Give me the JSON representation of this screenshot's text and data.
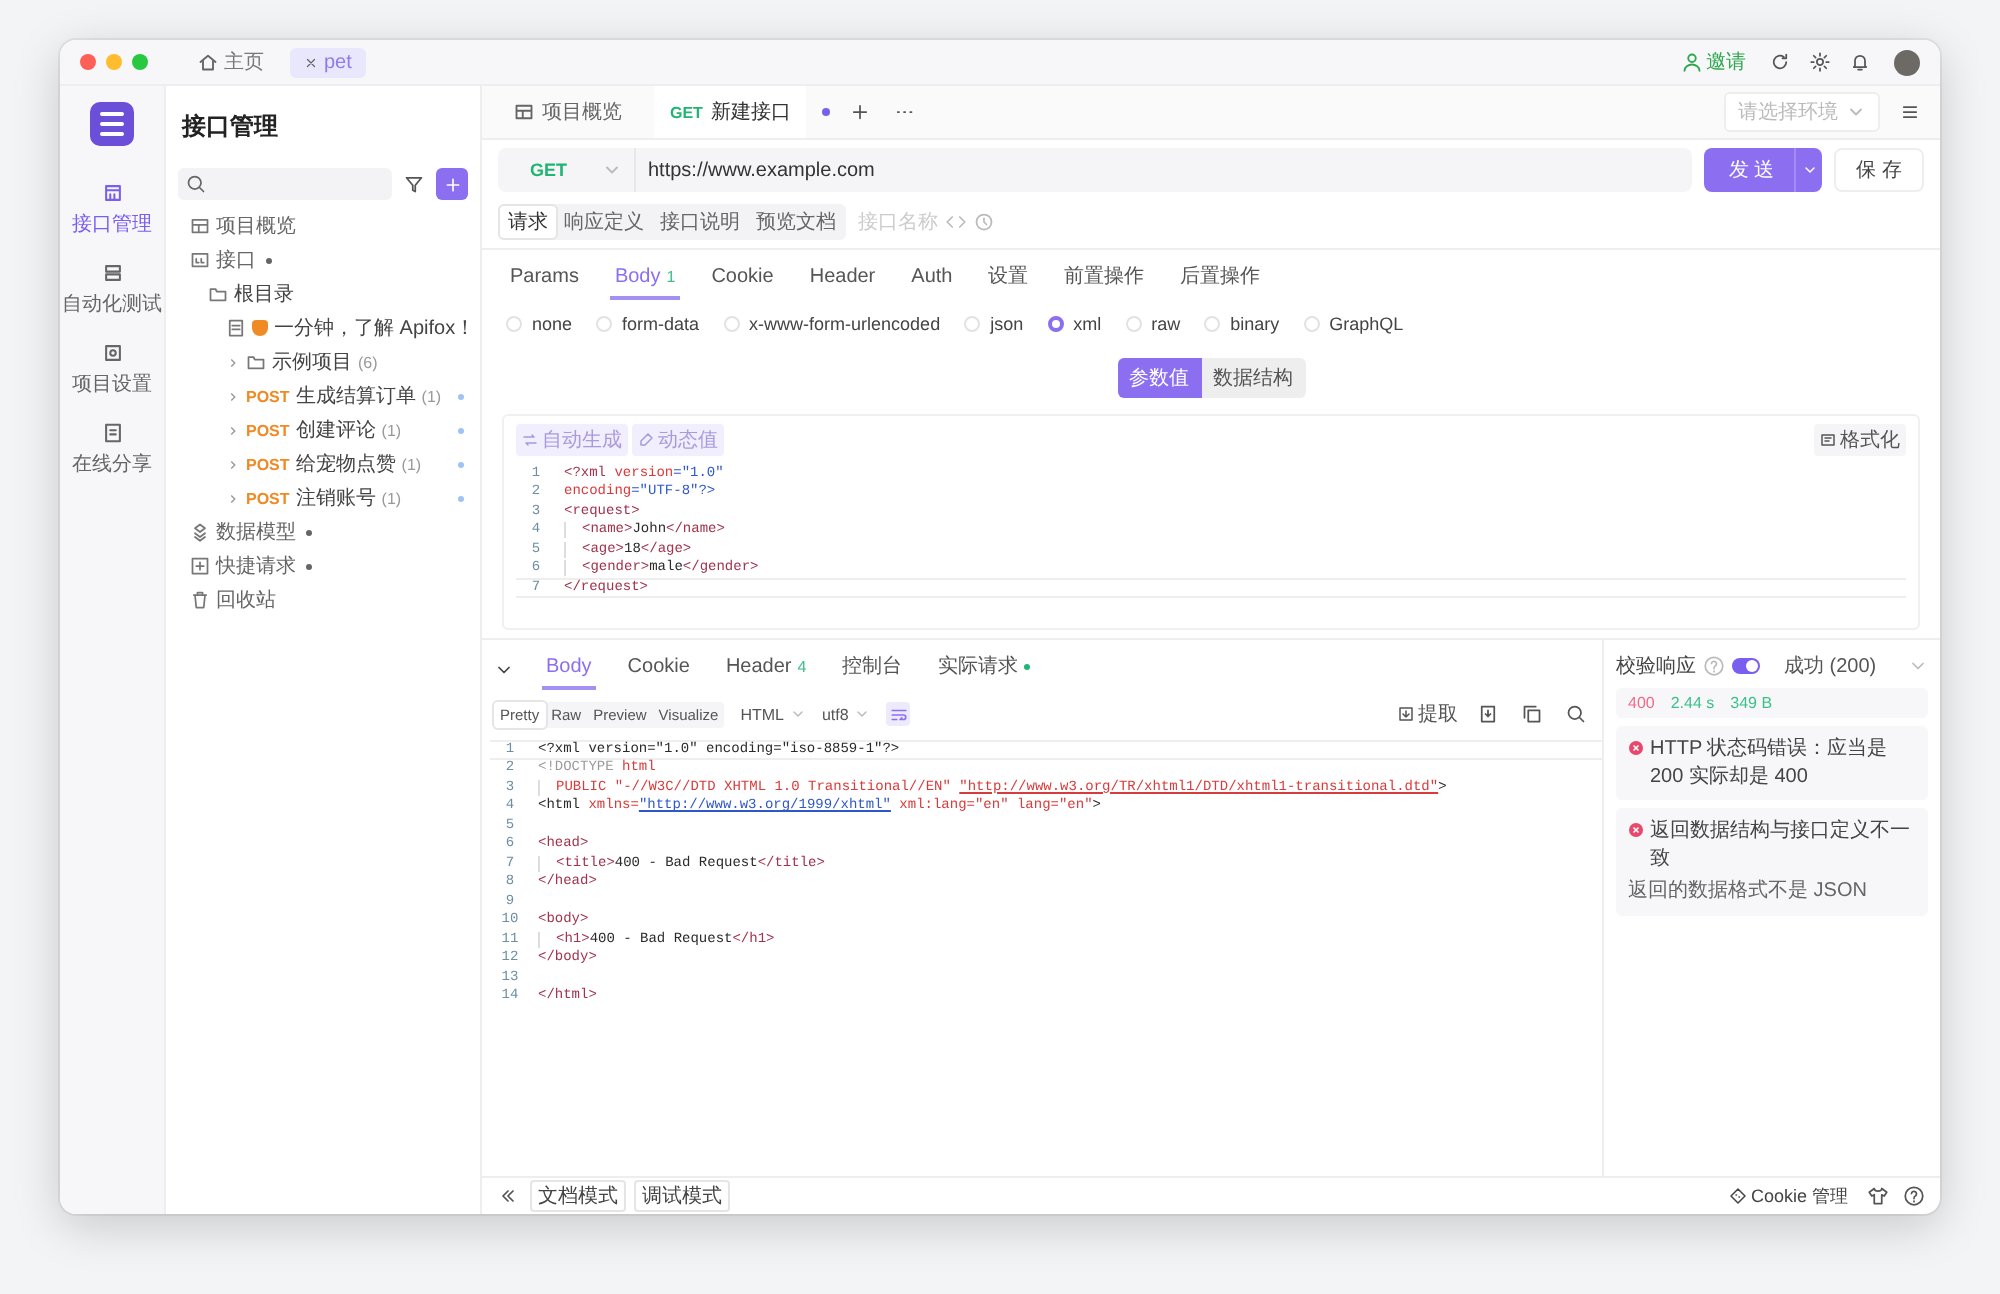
{
  "titlebar": {
    "tabs": [
      {
        "kind": "home",
        "label": "主页",
        "selected": false
      },
      {
        "kind": "project",
        "label": "pet",
        "selected": true
      }
    ],
    "invite": "邀请"
  },
  "rail": {
    "items": [
      {
        "kind": "api",
        "label": "接口管理",
        "selected": true
      },
      {
        "kind": "test",
        "label": "自动化测试",
        "selected": false
      },
      {
        "kind": "settings",
        "label": "项目设置",
        "selected": false
      },
      {
        "kind": "share",
        "label": "在线分享",
        "selected": false
      }
    ]
  },
  "sidebar": {
    "title": "接口管理",
    "tree": [
      {
        "kind": "overview",
        "label": "项目概览"
      },
      {
        "kind": "module",
        "label": "接口",
        "children": [
          {
            "kind": "folder",
            "label": "根目录",
            "children": [
              {
                "kind": "doc",
                "label": "一分钟，了解 Apifox！"
              },
              {
                "kind": "folder",
                "label": "示例项目",
                "count": "(6)",
                "expanded": false
              },
              {
                "kind": "endpoint",
                "method": "POST",
                "label": "生成结算订单",
                "count": "(1)",
                "expanded": false
              },
              {
                "kind": "endpoint",
                "method": "POST",
                "label": "创建评论",
                "count": "(1)",
                "expanded": false
              },
              {
                "kind": "endpoint",
                "method": "POST",
                "label": "给宠物点赞",
                "count": "(1)",
                "expanded": false
              },
              {
                "kind": "endpoint",
                "method": "POST",
                "label": "注销账号",
                "count": "(1)",
                "expanded": false
              }
            ]
          }
        ]
      },
      {
        "kind": "models",
        "label": "数据模型"
      },
      {
        "kind": "quick",
        "label": "快捷请求"
      },
      {
        "kind": "trash",
        "label": "回收站"
      }
    ]
  },
  "tabs": [
    {
      "kind": "overview",
      "label": "项目概览",
      "selected": false
    },
    {
      "kind": "endpoint",
      "method": "GET",
      "label": "新建接口",
      "selected": true,
      "unsaved": true
    }
  ],
  "environment": {
    "placeholder": "请选择环境"
  },
  "request": {
    "method": "GET",
    "url": "https://www.example.com",
    "send": "发 送",
    "save": "保 存"
  },
  "sections": [
    {
      "label": "请求",
      "selected": true
    },
    {
      "label": "响应定义",
      "selected": false
    },
    {
      "label": "接口说明",
      "selected": false
    },
    {
      "label": "预览文档",
      "selected": false
    }
  ],
  "name_field": {
    "placeholder": "接口名称"
  },
  "request_tabs": [
    {
      "label": "Params",
      "selected": false
    },
    {
      "label": "Body",
      "count": "1",
      "selected": true
    },
    {
      "label": "Cookie",
      "selected": false
    },
    {
      "label": "Header",
      "selected": false
    },
    {
      "label": "Auth",
      "selected": false
    },
    {
      "label": "设置",
      "selected": false
    },
    {
      "label": "前置操作",
      "selected": false
    },
    {
      "label": "后置操作",
      "selected": false
    }
  ],
  "body_types": [
    {
      "label": "none",
      "selected": false
    },
    {
      "label": "form-data",
      "selected": false
    },
    {
      "label": "x-www-form-urlencoded",
      "selected": false
    },
    {
      "label": "json",
      "selected": false
    },
    {
      "label": "xml",
      "selected": true
    },
    {
      "label": "raw",
      "selected": false
    },
    {
      "label": "binary",
      "selected": false
    },
    {
      "label": "GraphQL",
      "selected": false
    }
  ],
  "views": [
    {
      "label": "参数值",
      "selected": true
    },
    {
      "label": "数据结构",
      "selected": false
    }
  ],
  "editor": {
    "tools": [
      {
        "kind": "generate",
        "label": "自动生成"
      },
      {
        "kind": "dynamic",
        "label": "动态值"
      }
    ],
    "format": "格式化",
    "lines": [
      {
        "number": "1",
        "tokens": [
          {
            "kind": "tag",
            "text": "<?xml "
          },
          {
            "kind": "attr",
            "text": "version"
          },
          {
            "kind": "string",
            "text": "=\"1.0\""
          }
        ]
      },
      {
        "number": "2",
        "tokens": [
          {
            "kind": "attr",
            "text": "encoding"
          },
          {
            "kind": "string",
            "text": "=\"UTF-8\"?>"
          }
        ]
      },
      {
        "number": "3",
        "tokens": [
          {
            "kind": "tag",
            "text": "<request>"
          }
        ]
      },
      {
        "number": "4",
        "indented": true,
        "tokens": [
          {
            "kind": "tag",
            "text": "<name>"
          },
          {
            "kind": "text",
            "text": "John"
          },
          {
            "kind": "tag",
            "text": "</name>"
          }
        ]
      },
      {
        "number": "5",
        "indented": true,
        "tokens": [
          {
            "kind": "tag",
            "text": "<age>"
          },
          {
            "kind": "text",
            "text": "18"
          },
          {
            "kind": "tag",
            "text": "</age>"
          }
        ]
      },
      {
        "number": "6",
        "indented": true,
        "tokens": [
          {
            "kind": "tag",
            "text": "<gender>"
          },
          {
            "kind": "text",
            "text": "male"
          },
          {
            "kind": "tag",
            "text": "</gender>"
          }
        ]
      },
      {
        "number": "7",
        "cursor": true,
        "tokens": [
          {
            "kind": "tag",
            "text": "</request>"
          }
        ]
      }
    ]
  },
  "response": {
    "tabs": [
      {
        "label": "Body",
        "selected": true
      },
      {
        "label": "Cookie",
        "selected": false
      },
      {
        "label": "Header",
        "count": "4",
        "selected": false
      },
      {
        "label": "控制台",
        "selected": false
      },
      {
        "label": "实际请求",
        "dot": true,
        "selected": false
      }
    ],
    "modes": [
      {
        "label": "Pretty",
        "selected": true
      },
      {
        "label": "Raw",
        "selected": false
      },
      {
        "label": "Preview",
        "selected": false
      },
      {
        "label": "Visualize",
        "selected": false
      }
    ],
    "format": "HTML",
    "encoding": "utf8",
    "extract": "提取",
    "lines": [
      {
        "number": "1",
        "cursor": true,
        "tokens": [
          {
            "kind": "text",
            "text": "<?xml version=\"1.0\" encoding=\"iso-8859-1\"?>"
          }
        ]
      },
      {
        "number": "2",
        "tokens": [
          {
            "kind": "meta",
            "text": "<!DOCTYPE "
          },
          {
            "kind": "attr",
            "text": "html"
          }
        ]
      },
      {
        "number": "3",
        "indented": true,
        "tokens": [
          {
            "kind": "attr",
            "text": "PUBLIC \"-//W3C//DTD XHTML 1.0 Transitional//EN\" "
          },
          {
            "kind": "link",
            "text": "\"http://www.w3.org/TR/xhtml1/DTD/xhtml1-transitional.dtd\""
          },
          {
            "kind": "text",
            "text": ">"
          }
        ]
      },
      {
        "number": "4",
        "tokens": [
          {
            "kind": "text",
            "text": "<html "
          },
          {
            "kind": "attr",
            "text": "xmlns="
          },
          {
            "kind": "url",
            "text": "\"http://www.w3.org/1999/xhtml\""
          },
          {
            "kind": "attr",
            "text": " xml:lang=\"en\" lang=\"en\""
          },
          {
            "kind": "text",
            "text": ">"
          }
        ]
      },
      {
        "number": "5"
      },
      {
        "number": "6",
        "tokens": [
          {
            "kind": "tag",
            "text": "<head>"
          }
        ]
      },
      {
        "number": "7",
        "indented": true,
        "tokens": [
          {
            "kind": "tag",
            "text": "<title>"
          },
          {
            "kind": "text",
            "text": "400 - Bad Request"
          },
          {
            "kind": "tag",
            "text": "</title>"
          }
        ]
      },
      {
        "number": "8",
        "tokens": [
          {
            "kind": "tag",
            "text": "</head>"
          }
        ]
      },
      {
        "number": "9"
      },
      {
        "number": "10",
        "tokens": [
          {
            "kind": "tag",
            "text": "<body>"
          }
        ]
      },
      {
        "number": "11",
        "indented": true,
        "tokens": [
          {
            "kind": "tag",
            "text": "<h1>"
          },
          {
            "kind": "text",
            "text": "400 - Bad Request"
          },
          {
            "kind": "tag",
            "text": "</h1>"
          }
        ]
      },
      {
        "number": "12",
        "tokens": [
          {
            "kind": "tag",
            "text": "</body>"
          }
        ]
      },
      {
        "number": "13"
      },
      {
        "number": "14",
        "tokens": [
          {
            "kind": "tag",
            "text": "</html>"
          }
        ]
      }
    ]
  },
  "validation": {
    "label": "校验响应",
    "enabled": true,
    "result": "成功 (200)",
    "status": "400",
    "time": "2.44 s",
    "size": "349 B",
    "errors": [
      {
        "title": "HTTP 状态码错误：应当是 200 实际却是 400"
      },
      {
        "title": "返回数据结构与接口定义不一致",
        "detail": "返回的数据格式不是 JSON"
      }
    ]
  },
  "footer": {
    "modes": [
      "文档模式",
      "调试模式"
    ],
    "cookie": "Cookie 管理"
  }
}
